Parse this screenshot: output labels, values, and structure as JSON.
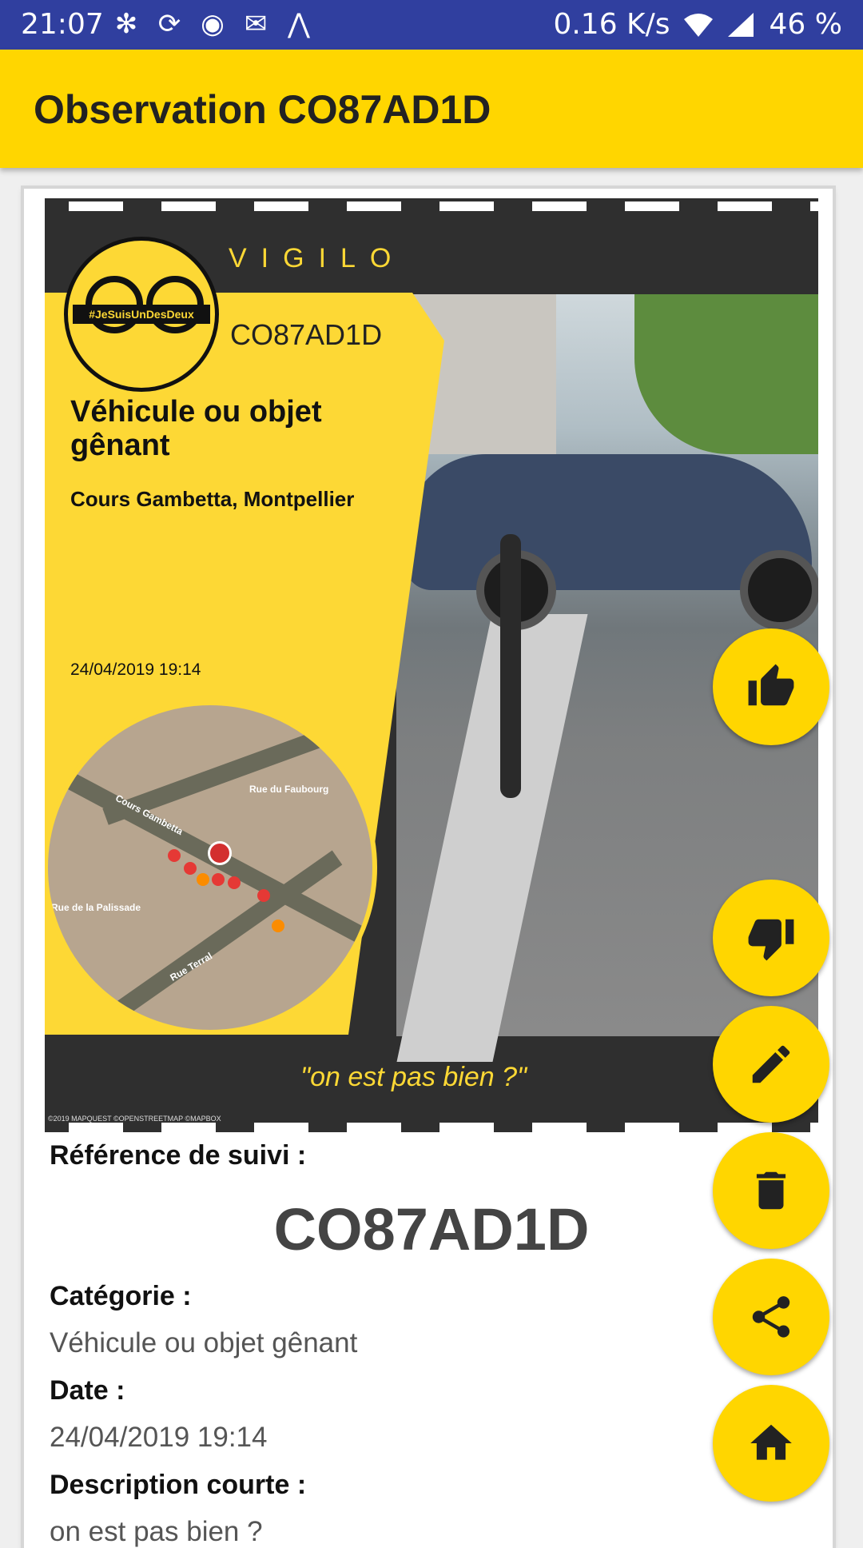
{
  "status_bar": {
    "time": "21:07",
    "speed": "0.16 K/s",
    "battery": "46 %"
  },
  "app_bar": {
    "title": "Observation CO87AD1D"
  },
  "poster": {
    "brand": "VIGILO",
    "logo_tag": "#JeSuisUnDesDeux",
    "token": "CO87AD1D",
    "category": "Véhicule ou objet gênant",
    "address": "Cours Gambetta, Montpellier",
    "datetime": "24/04/2019 19:14",
    "quote": "\"on est pas bien ?\"",
    "credits": "©2019 MAPQUEST ©OPENSTREETMAP ©MAPBOX",
    "map_labels": [
      "Rue du Faubourg",
      "Cours Gambetta",
      "Rue de la Palissade",
      "Rue Terral"
    ]
  },
  "details": {
    "ref_label": "Référence de suivi :",
    "ref_value": "CO87AD1D",
    "category_label": "Catégorie :",
    "category_value": "Véhicule ou objet gênant",
    "date_label": "Date :",
    "date_value": "24/04/2019 19:14",
    "desc_label": "Description courte :",
    "desc_value": "on est pas bien ?"
  },
  "fabs": [
    "thumb-up",
    "thumb-down",
    "edit",
    "delete",
    "share",
    "home"
  ],
  "colors": {
    "status_bar": "#303f9f",
    "accent": "#ffd600",
    "poster_yellow": "#fdd835",
    "poster_dark": "#2f2f2f"
  }
}
